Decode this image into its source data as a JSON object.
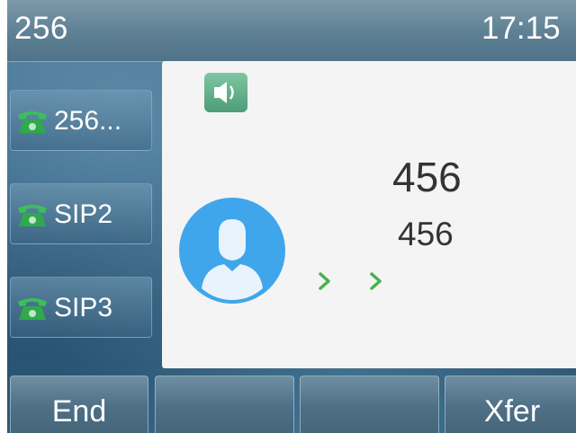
{
  "statusbar": {
    "account": "256",
    "time": "17:15"
  },
  "line_keys": [
    {
      "label": "256...",
      "icon": "phone-icon"
    },
    {
      "label": "SIP2",
      "icon": "phone-icon"
    },
    {
      "label": "SIP3",
      "icon": "phone-icon"
    }
  ],
  "call": {
    "mode_icon": "speaker-icon",
    "caller_name": "456",
    "caller_number": "456",
    "status_icons": [
      "chevron-right-icon",
      "chevron-right-icon"
    ]
  },
  "softkeys": [
    {
      "label": "End"
    },
    {
      "label": ""
    },
    {
      "label": ""
    },
    {
      "label": "Xfer"
    }
  ],
  "colors": {
    "accent_green": "#4caf50",
    "avatar_blue": "#3fa6ec",
    "panel_bg": "#f4f4f4"
  }
}
